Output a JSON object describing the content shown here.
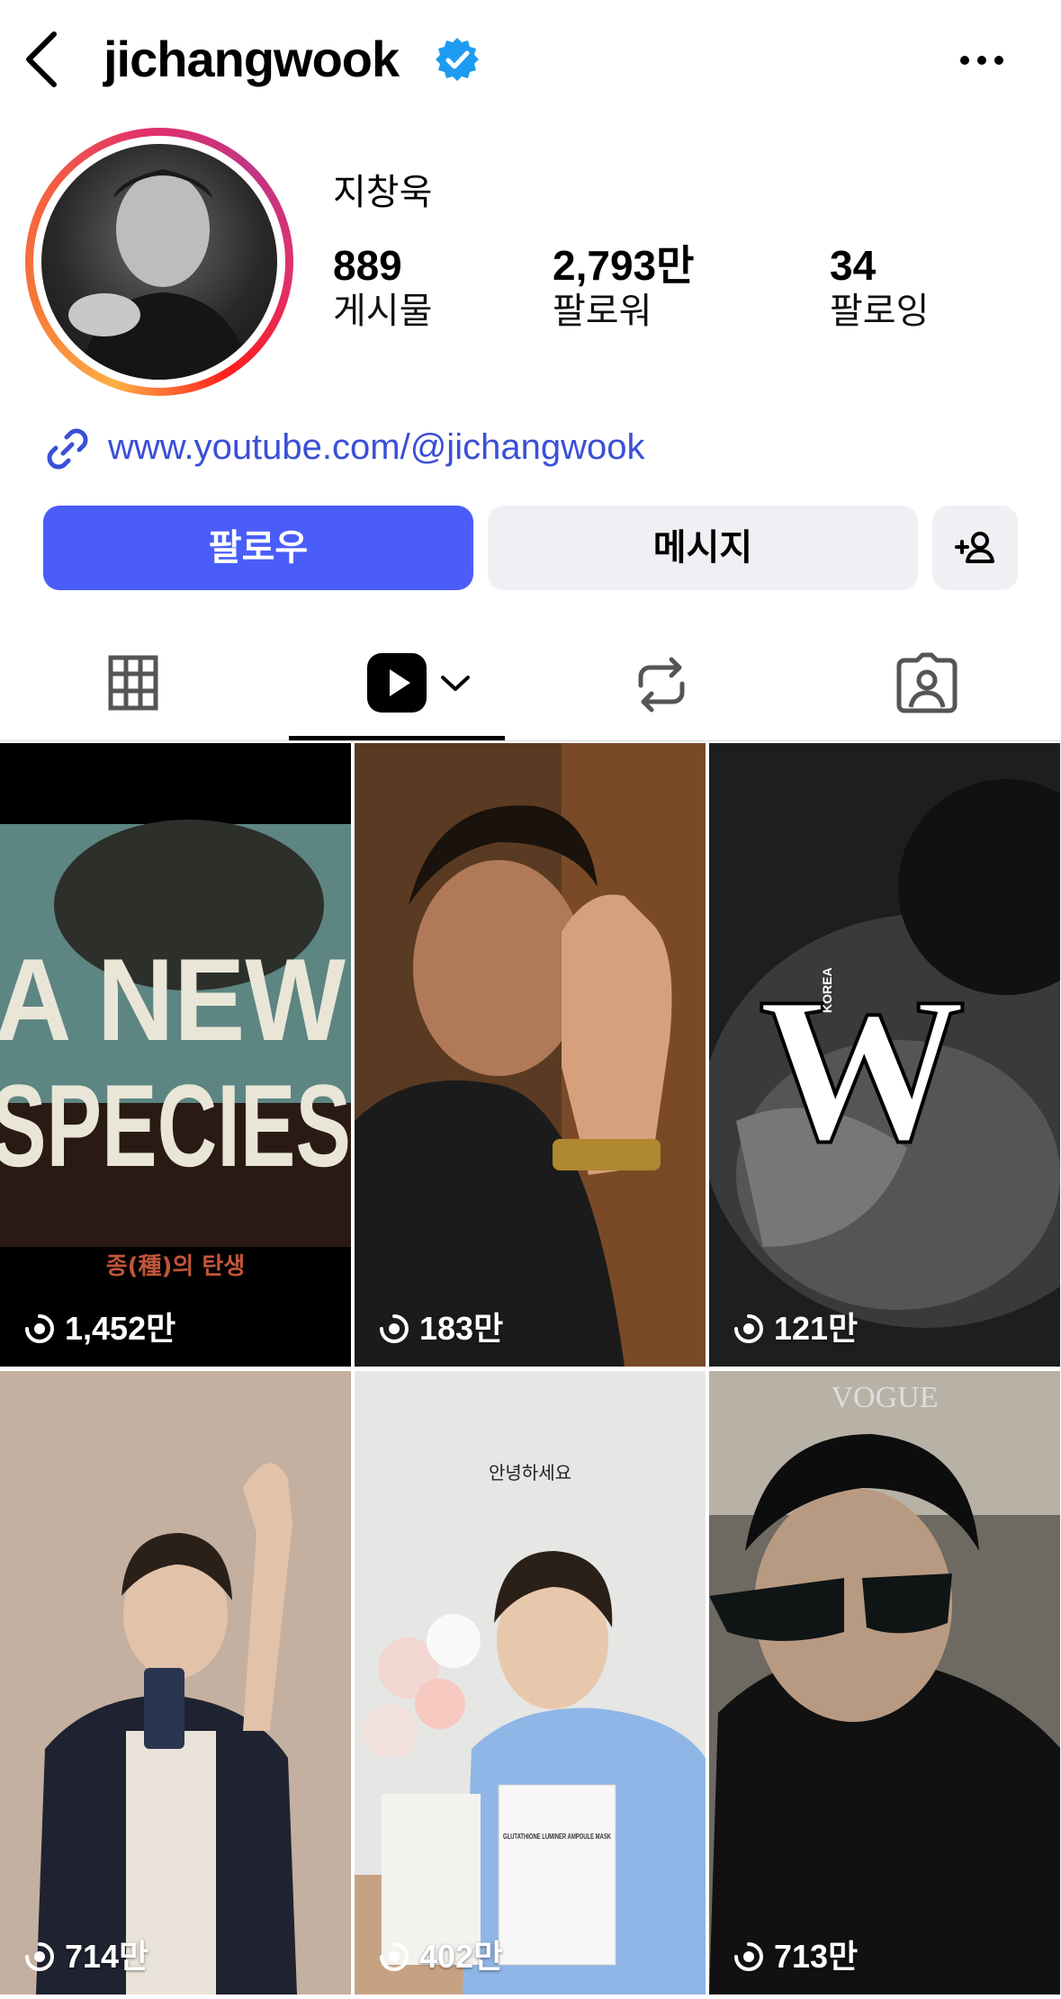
{
  "header": {
    "username": "jichangwook",
    "icons": [
      "back-chevron",
      "verified-badge",
      "more-horizontal"
    ]
  },
  "profile": {
    "display_name": "지창욱",
    "stats": [
      {
        "value": "889",
        "label": "게시물"
      },
      {
        "value": "2,793만",
        "label": "팔로워"
      },
      {
        "value": "34",
        "label": "팔로잉"
      }
    ],
    "link": "www.youtube.com/@jichangwook"
  },
  "actions": {
    "follow_label": "팔로우",
    "message_label": "메시지",
    "add_icon": "person-add"
  },
  "tabs": [
    {
      "name": "grid",
      "icon": "grid-icon"
    },
    {
      "name": "reels",
      "icon": "reels-icon",
      "active": true
    },
    {
      "name": "reposts",
      "icon": "repost-icon"
    },
    {
      "name": "tagged",
      "icon": "tagged-icon"
    }
  ],
  "reels": [
    {
      "views": "1,452만",
      "overlay_lines": [
        "A NEW",
        "SPECIES"
      ],
      "subtitle": "종(種)의 탄생"
    },
    {
      "views": "183만"
    },
    {
      "views": "121만",
      "overlay_text": "W",
      "overlay_small": "KOREA"
    },
    {
      "views": "714만"
    },
    {
      "views": "402만",
      "overlay_text": "안녕하세요",
      "product_text": "GLUTATHIONE LUMINER AMPOULE MASK"
    },
    {
      "views": "713만",
      "overlay_text": "VOGUE"
    }
  ],
  "colors": {
    "accent": "#4a5df9",
    "link": "#3b4fd8",
    "verified": "#1d9bf0"
  }
}
